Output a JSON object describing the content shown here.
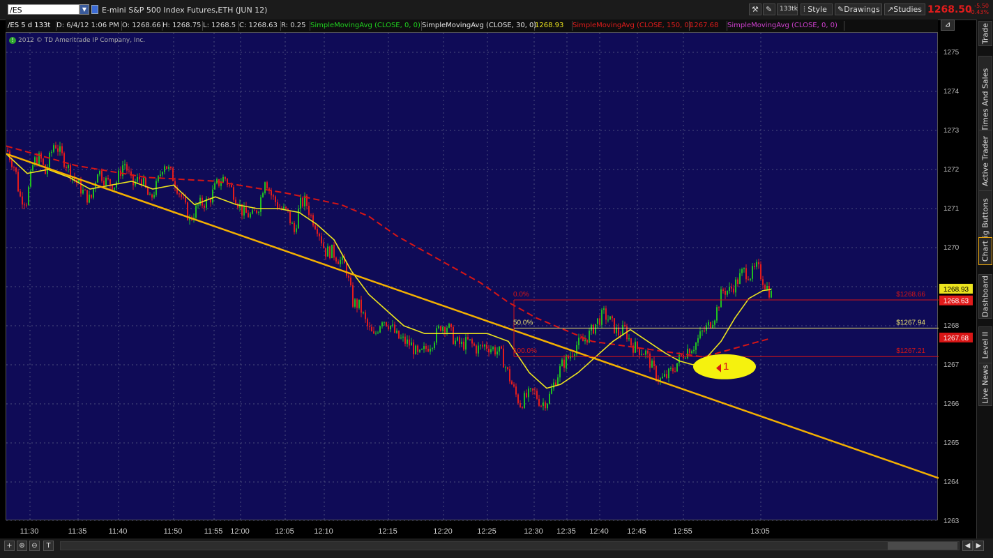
{
  "header": {
    "symbol": "/ES",
    "description": "E-mini S&P 500 Index Futures,ETH (JUN 12)",
    "tick_button": "133tk",
    "style_label": "Style",
    "drawings_label": "Drawings",
    "studies_label": "Studies",
    "last_price": "1268.50",
    "change": "-5.50",
    "change_pct": "-0.43%"
  },
  "info": {
    "chart_id": "/ES 5 d 133t",
    "date": "D: 6/4/12 1:06 PM",
    "open": "O: 1268.66",
    "high": "H: 1268.75",
    "low": "L: 1268.5",
    "close": "C: 1268.63",
    "range": "R: 0.25",
    "sma1": "SimpleMovingAvg (CLOSE, 0, 0)",
    "sma2": "SimpleMovingAvg (CLOSE, 30, 0)",
    "sma2_val": "1268.93",
    "sma3": "SimpleMovingAvg (CLOSE, 150, 0)",
    "sma3_val": "1267.68",
    "sma4": "SimpleMovingAvg (CLOSE, 0, 0)",
    "copyright": "2012 © TD Ameritrade IP Company, Inc."
  },
  "colors": {
    "background": "#0f0b57",
    "up": "#20c020",
    "down": "#e31c1c",
    "sma30": "#ece41e",
    "sma150": "#d81515",
    "trendline": "#f4b000",
    "fib": "#d81515",
    "grid": "#4b4e7e"
  },
  "chart_data": {
    "type": "candlestick",
    "ylim": [
      1263,
      1275.5
    ],
    "yticks": [
      1263,
      1264,
      1265,
      1266,
      1267,
      1268,
      1269,
      1270,
      1271,
      1272,
      1273,
      1274,
      1275
    ],
    "xticks": [
      "11:30",
      "11:35",
      "11:40",
      "11:50",
      "11:55",
      "12:00",
      "12:05",
      "12:10",
      "12:15",
      "12:20",
      "12:25",
      "12:30",
      "12:35",
      "12:40",
      "12:45",
      "12:55",
      "13:05"
    ],
    "price_path": [
      [
        0,
        1272.5
      ],
      [
        12,
        1272.0
      ],
      [
        18,
        1271.3
      ],
      [
        28,
        1271.2
      ],
      [
        38,
        1272.2
      ],
      [
        48,
        1272.3
      ],
      [
        55,
        1271.9
      ],
      [
        68,
        1272.7
      ],
      [
        80,
        1272.3
      ],
      [
        95,
        1271.8
      ],
      [
        110,
        1271.4
      ],
      [
        120,
        1271.2
      ],
      [
        130,
        1272.0
      ],
      [
        142,
        1271.7
      ],
      [
        155,
        1271.6
      ],
      [
        168,
        1272.2
      ],
      [
        180,
        1271.6
      ],
      [
        192,
        1271.8
      ],
      [
        205,
        1271.2
      ],
      [
        215,
        1271.6
      ],
      [
        225,
        1272.2
      ],
      [
        238,
        1271.8
      ],
      [
        250,
        1271.3
      ],
      [
        262,
        1270.7
      ],
      [
        275,
        1271.1
      ],
      [
        290,
        1271.2
      ],
      [
        300,
        1271.6
      ],
      [
        312,
        1271.8
      ],
      [
        325,
        1271.4
      ],
      [
        338,
        1270.9
      ],
      [
        352,
        1270.8
      ],
      [
        362,
        1271.1
      ],
      [
        370,
        1271.8
      ],
      [
        380,
        1271.3
      ],
      [
        392,
        1271.0
      ],
      [
        402,
        1270.9
      ],
      [
        412,
        1270.4
      ],
      [
        420,
        1271.1
      ],
      [
        428,
        1271.2
      ],
      [
        436,
        1270.8
      ],
      [
        446,
        1270.5
      ],
      [
        456,
        1269.9
      ],
      [
        466,
        1269.9
      ],
      [
        476,
        1269.7
      ],
      [
        486,
        1269.5
      ],
      [
        496,
        1268.6
      ],
      [
        506,
        1268.5
      ],
      [
        516,
        1268.0
      ],
      [
        526,
        1267.7
      ],
      [
        538,
        1268.2
      ],
      [
        550,
        1268.0
      ],
      [
        560,
        1267.7
      ],
      [
        570,
        1267.6
      ],
      [
        580,
        1267.5
      ],
      [
        590,
        1267.2
      ],
      [
        600,
        1267.4
      ],
      [
        610,
        1267.6
      ],
      [
        622,
        1268.0
      ],
      [
        632,
        1268.0
      ],
      [
        642,
        1267.6
      ],
      [
        652,
        1267.5
      ],
      [
        662,
        1267.6
      ],
      [
        674,
        1267.4
      ],
      [
        686,
        1267.5
      ],
      [
        698,
        1267.4
      ],
      [
        708,
        1267.3
      ],
      [
        718,
        1266.8
      ],
      [
        728,
        1266.3
      ],
      [
        736,
        1266.0
      ],
      [
        746,
        1266.2
      ],
      [
        756,
        1266.3
      ],
      [
        766,
        1266.0
      ],
      [
        776,
        1266.1
      ],
      [
        786,
        1266.6
      ],
      [
        796,
        1267.0
      ],
      [
        806,
        1267.2
      ],
      [
        816,
        1267.5
      ],
      [
        826,
        1267.6
      ],
      [
        836,
        1267.8
      ],
      [
        846,
        1268.1
      ],
      [
        856,
        1268.3
      ],
      [
        866,
        1268.1
      ],
      [
        876,
        1267.8
      ],
      [
        886,
        1267.9
      ],
      [
        896,
        1267.5
      ],
      [
        906,
        1267.4
      ],
      [
        916,
        1267.3
      ],
      [
        926,
        1266.9
      ],
      [
        936,
        1266.6
      ],
      [
        946,
        1266.7
      ],
      [
        956,
        1266.9
      ],
      [
        966,
        1267.2
      ],
      [
        976,
        1267.4
      ],
      [
        986,
        1267.5
      ],
      [
        996,
        1267.8
      ],
      [
        1006,
        1268.0
      ],
      [
        1016,
        1268.3
      ],
      [
        1026,
        1268.9
      ],
      [
        1036,
        1268.9
      ],
      [
        1046,
        1269.1
      ],
      [
        1056,
        1269.4
      ],
      [
        1066,
        1269.3
      ],
      [
        1076,
        1269.5
      ],
      [
        1086,
        1269.1
      ],
      [
        1096,
        1268.8
      ]
    ],
    "sma30": [
      [
        0,
        1272.4
      ],
      [
        30,
        1271.9
      ],
      [
        60,
        1272.0
      ],
      [
        90,
        1271.8
      ],
      [
        120,
        1271.5
      ],
      [
        150,
        1271.6
      ],
      [
        180,
        1271.7
      ],
      [
        210,
        1271.5
      ],
      [
        240,
        1271.6
      ],
      [
        270,
        1271.1
      ],
      [
        300,
        1271.3
      ],
      [
        330,
        1271.1
      ],
      [
        360,
        1271.0
      ],
      [
        390,
        1271.0
      ],
      [
        420,
        1270.9
      ],
      [
        445,
        1270.6
      ],
      [
        470,
        1270.2
      ],
      [
        495,
        1269.4
      ],
      [
        520,
        1268.8
      ],
      [
        545,
        1268.4
      ],
      [
        570,
        1268.0
      ],
      [
        600,
        1267.8
      ],
      [
        630,
        1267.8
      ],
      [
        660,
        1267.8
      ],
      [
        690,
        1267.8
      ],
      [
        720,
        1267.6
      ],
      [
        750,
        1266.8
      ],
      [
        775,
        1266.4
      ],
      [
        795,
        1266.5
      ],
      [
        820,
        1266.8
      ],
      [
        845,
        1267.2
      ],
      [
        870,
        1267.6
      ],
      [
        895,
        1267.9
      ],
      [
        920,
        1267.6
      ],
      [
        945,
        1267.3
      ],
      [
        965,
        1267.1
      ],
      [
        985,
        1267.0
      ],
      [
        1005,
        1267.2
      ],
      [
        1025,
        1267.6
      ],
      [
        1045,
        1268.2
      ],
      [
        1065,
        1268.7
      ],
      [
        1085,
        1268.9
      ],
      [
        1097,
        1268.93
      ]
    ],
    "sma150": [
      [
        0,
        1272.6
      ],
      [
        100,
        1272.1
      ],
      [
        200,
        1271.8
      ],
      [
        300,
        1271.7
      ],
      [
        400,
        1271.4
      ],
      [
        480,
        1271.1
      ],
      [
        520,
        1270.8
      ],
      [
        560,
        1270.3
      ],
      [
        600,
        1269.9
      ],
      [
        640,
        1269.5
      ],
      [
        680,
        1269.1
      ],
      [
        720,
        1268.6
      ],
      [
        760,
        1268.2
      ],
      [
        800,
        1267.9
      ],
      [
        840,
        1267.6
      ],
      [
        880,
        1267.5
      ],
      [
        920,
        1267.4
      ],
      [
        960,
        1267.3
      ],
      [
        1000,
        1267.2
      ],
      [
        1040,
        1267.4
      ],
      [
        1070,
        1267.55
      ],
      [
        1097,
        1267.68
      ]
    ],
    "trendline": {
      "start": [
        0,
        1272.4
      ],
      "end": [
        1337,
        1264.1
      ]
    },
    "fib": {
      "x_start": 728,
      "levels": [
        {
          "pct": "0.0%",
          "price": 1268.66,
          "label": "$1268.66"
        },
        {
          "pct": "50.0%",
          "price": 1267.94,
          "label": "$1267.94"
        },
        {
          "pct": "100.0%",
          "price": 1267.21,
          "label": "$1267.21"
        }
      ]
    },
    "annotation": {
      "text": "1",
      "price": 1266.95,
      "x": 1030
    },
    "price_labels": [
      {
        "value": "1268.93",
        "color": "#ece41e",
        "price": 1268.93
      },
      {
        "value": "1268.63",
        "color": "#e31c1c",
        "price": 1268.63
      },
      {
        "value": "1267.68",
        "color": "#d81515",
        "price": 1267.68
      }
    ]
  },
  "sidebar": {
    "tabs": [
      "Trade",
      "Times And Sales",
      "Active Trader",
      "Big Buttons",
      "Chart",
      "Dashboard",
      "Level II",
      "Live News"
    ]
  },
  "bottom": {
    "buttons": [
      "+",
      "⊕",
      "⊖",
      "T"
    ]
  }
}
